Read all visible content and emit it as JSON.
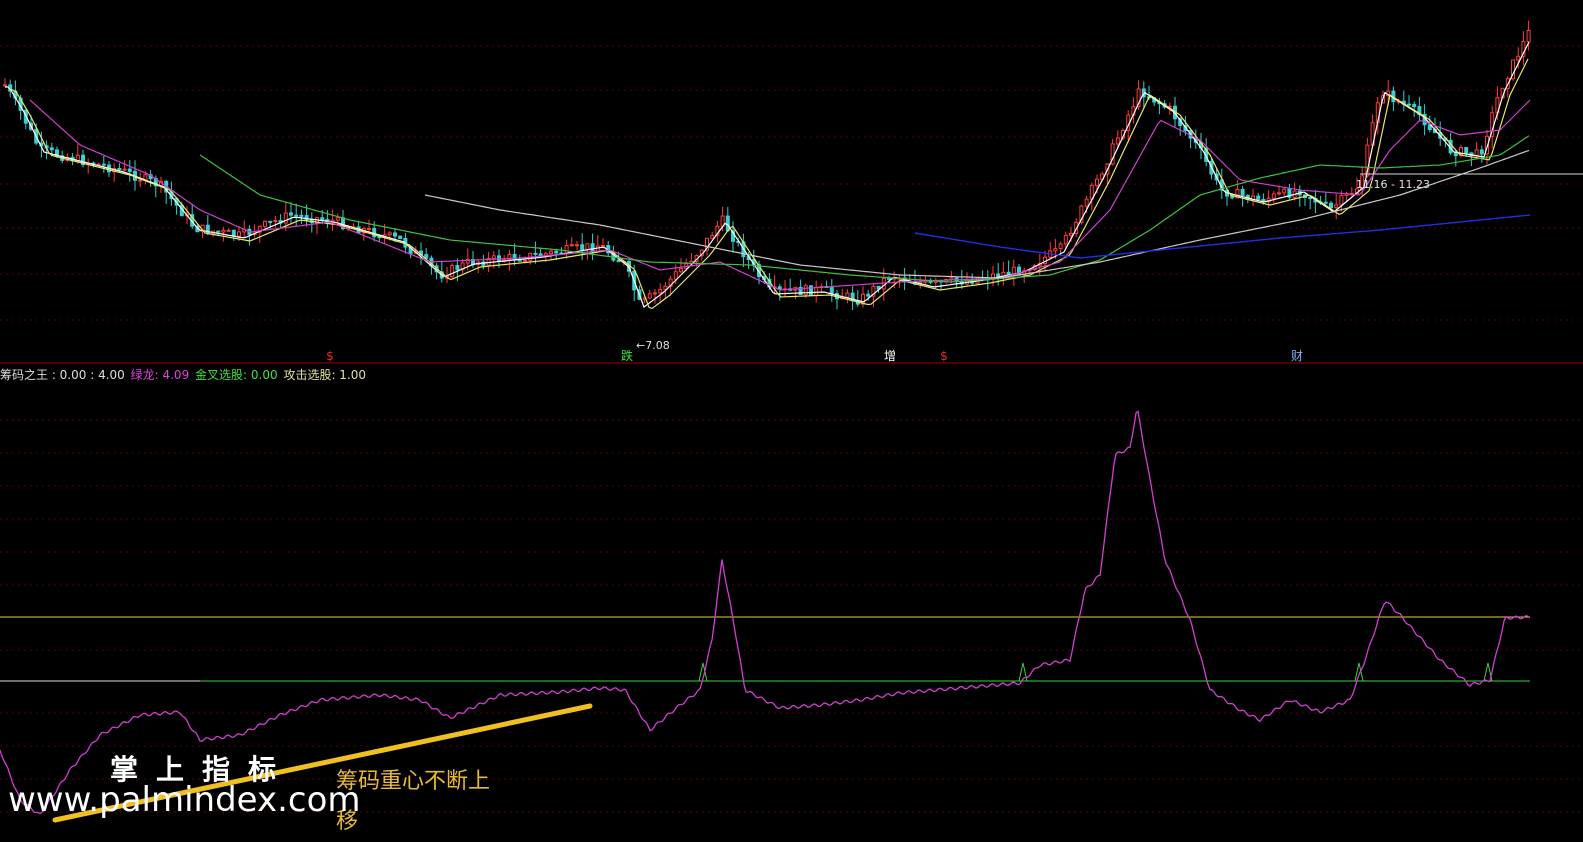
{
  "chart_data": [
    {
      "type": "candlestick",
      "annotations": {
        "low_label": "←7.08",
        "range_label": "11.16 - 11.23",
        "signals": [
          {
            "text": "$",
            "color": "#e03030"
          },
          {
            "text": "跌",
            "color": "#40e040"
          },
          {
            "text": "增",
            "color": "#ffffff"
          },
          {
            "text": "$",
            "color": "#e03030"
          },
          {
            "text": "财",
            "color": "#80b0ff"
          }
        ]
      },
      "grid": true
    },
    {
      "type": "line",
      "title": "筹码之王",
      "legend": [
        {
          "text": "筹码之王 : 0.00 : 4.00",
          "color": "#dddddd"
        },
        {
          "text": "绿龙: 4.09",
          "color": "#e040e0"
        },
        {
          "text": "金叉选股: 0.00",
          "color": "#40e040"
        },
        {
          "text": "攻击选股: 1.00",
          "color": "#e0e0a0"
        }
      ],
      "series": [
        {
          "name": "绿龙",
          "color": "#d040d0"
        }
      ],
      "grid": true
    }
  ],
  "watermark": {
    "brand": "掌上指标",
    "url": "www.palmindex.com"
  },
  "annotation_text": "筹码重心不断上移",
  "colors": {
    "background": "#000000",
    "up": "#ff3b3b",
    "down": "#39d0d0",
    "ma5": "#ffffff",
    "ma10": "#e8e86a",
    "ma20": "#d040d0",
    "ma60": "#40c040",
    "ma120": "#c8c8c8",
    "ma250": "#2030e0",
    "grid": "#5a0000",
    "divider": "#a00000",
    "upper_level": "#e8d040",
    "lower_level": "#40d040",
    "arrow": "#f0c020"
  }
}
